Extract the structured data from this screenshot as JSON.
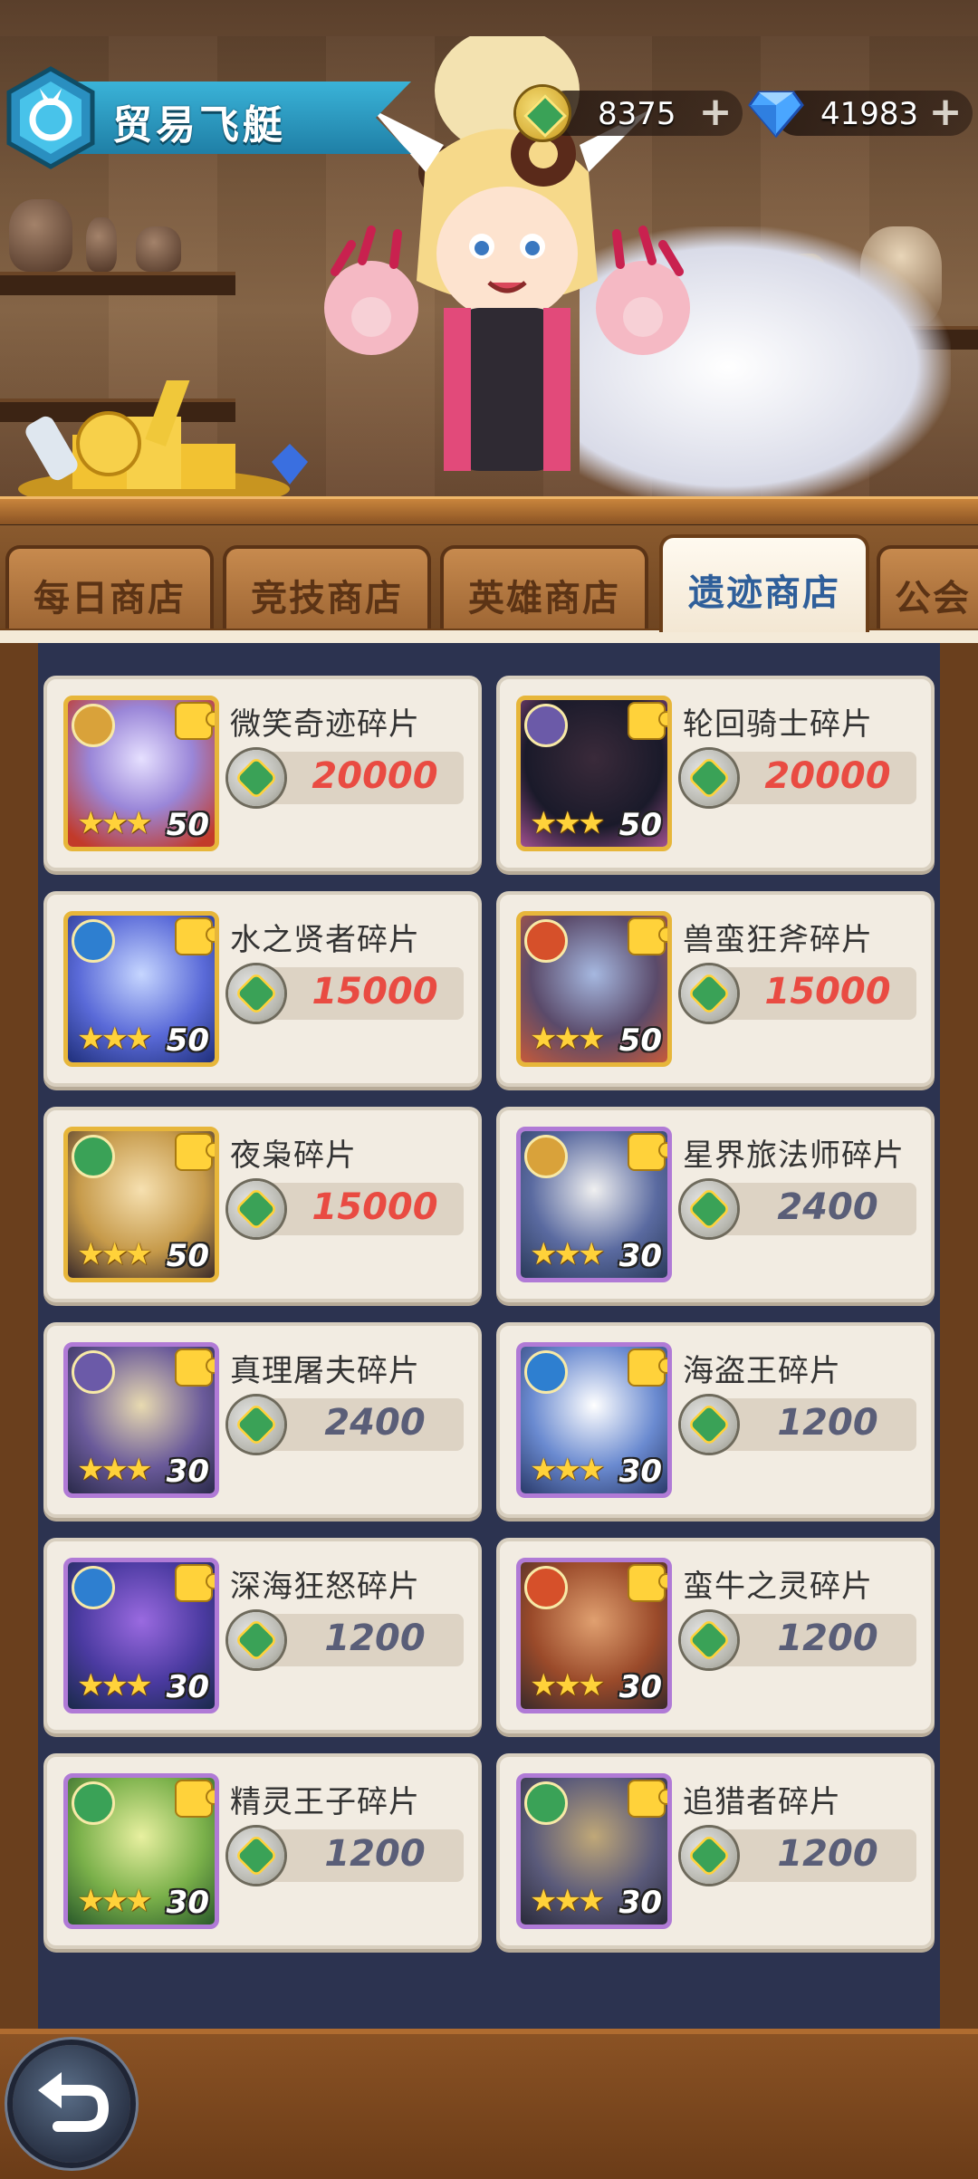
{
  "header": {
    "title": "贸易飞艇",
    "currencies": [
      {
        "name": "coin",
        "value": "8375"
      },
      {
        "name": "diamond",
        "value": "41983"
      }
    ]
  },
  "tabs": [
    {
      "label": "每日商店",
      "active": false
    },
    {
      "label": "竞技商店",
      "active": false
    },
    {
      "label": "英雄商店",
      "active": false
    },
    {
      "label": "遗迹商店",
      "active": true
    },
    {
      "label": "公会",
      "active": false
    }
  ],
  "items": [
    {
      "name": "微笑奇迹碎片",
      "price": "20000",
      "count": "50",
      "stars": 3,
      "frame": "gold",
      "faction": "light",
      "price_color": "red"
    },
    {
      "name": "轮回骑士碎片",
      "price": "20000",
      "count": "50",
      "stars": 3,
      "frame": "gold",
      "faction": "dark",
      "price_color": "red"
    },
    {
      "name": "水之贤者碎片",
      "price": "15000",
      "count": "50",
      "stars": 3,
      "frame": "gold",
      "faction": "water",
      "price_color": "red"
    },
    {
      "name": "兽蛮狂斧碎片",
      "price": "15000",
      "count": "50",
      "stars": 3,
      "frame": "gold",
      "faction": "fire",
      "price_color": "red"
    },
    {
      "name": "夜枭碎片",
      "price": "15000",
      "count": "50",
      "stars": 3,
      "frame": "gold",
      "faction": "nature",
      "price_color": "red"
    },
    {
      "name": "星界旅法师碎片",
      "price": "2400",
      "count": "30",
      "stars": 3,
      "frame": "purple",
      "faction": "light",
      "price_color": "slate"
    },
    {
      "name": "真理屠夫碎片",
      "price": "2400",
      "count": "30",
      "stars": 3,
      "frame": "purple",
      "faction": "dark",
      "price_color": "slate"
    },
    {
      "name": "海盗王碎片",
      "price": "1200",
      "count": "30",
      "stars": 3,
      "frame": "purple",
      "faction": "water",
      "price_color": "slate"
    },
    {
      "name": "深海狂怒碎片",
      "price": "1200",
      "count": "30",
      "stars": 3,
      "frame": "purple",
      "faction": "water",
      "price_color": "slate"
    },
    {
      "name": "蛮牛之灵碎片",
      "price": "1200",
      "count": "30",
      "stars": 3,
      "frame": "purple",
      "faction": "fire",
      "price_color": "slate"
    },
    {
      "name": "精灵王子碎片",
      "price": "1200",
      "count": "30",
      "stars": 3,
      "frame": "purple",
      "faction": "nature",
      "price_color": "slate"
    },
    {
      "name": "追猎者碎片",
      "price": "1200",
      "count": "30",
      "stars": 3,
      "frame": "purple",
      "faction": "nature",
      "price_color": "slate"
    }
  ],
  "icons": {
    "title_emblem": "crystal-emblem-icon",
    "coin": "relic-coin-icon",
    "diamond": "diamond-icon",
    "plus": "plus-icon",
    "fragment": "puzzle-piece-icon",
    "back": "back-arrow-icon"
  },
  "colors": {
    "price_red": "#e94b42",
    "price_slate": "#5a5e78",
    "active_tab_text": "#2f5f9a",
    "faction_light": "#d9a23a",
    "faction_dark": "#6b5aa8",
    "faction_water": "#2e7fd0",
    "faction_fire": "#d6502a",
    "faction_nature": "#3aa257"
  }
}
